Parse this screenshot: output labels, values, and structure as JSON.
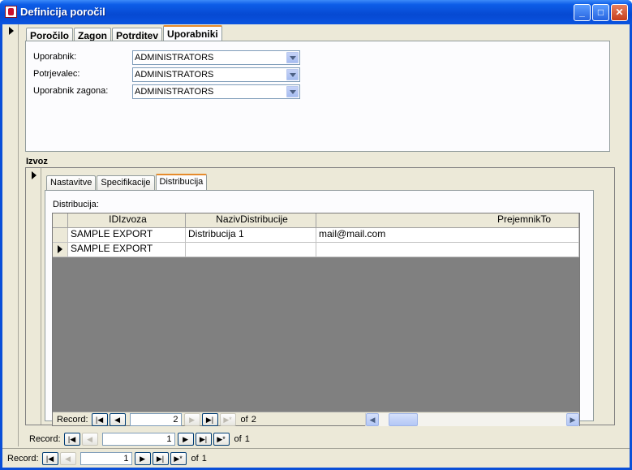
{
  "window": {
    "title": "Definicija poročil",
    "minimize_glyph": "_",
    "maximize_glyph": "□",
    "close_glyph": "✕"
  },
  "main_tabs": [
    "Poročilo",
    "Zagon",
    "Potrditev",
    "Uporabniki"
  ],
  "uporabniki": {
    "fields": [
      {
        "label": "Uporabnik:",
        "value": "ADMINISTRATORS"
      },
      {
        "label": "Potrjevalec:",
        "value": "ADMINISTRATORS"
      },
      {
        "label": "Uporabnik zagona:",
        "value": "ADMINISTRATORS"
      }
    ]
  },
  "izvoz": {
    "label": "Izvoz",
    "tabs": [
      "Nastavitve",
      "Specifikacije",
      "Distribucija"
    ],
    "distribucija": {
      "label": "Distribucija:",
      "columns": [
        "IDIzvoza",
        "NazivDistribucije",
        "PrejemnikTo"
      ],
      "rows": [
        [
          "SAMPLE EXPORT",
          "Distribucija 1",
          "mail@mail.com"
        ],
        [
          "SAMPLE EXPORT",
          "",
          ""
        ]
      ]
    }
  },
  "nav_inner": {
    "label": "Record:",
    "current": "2",
    "of_label": "of",
    "total": "2"
  },
  "nav_middle": {
    "label": "Record:",
    "current": "1",
    "of_label": "of",
    "total": "1"
  },
  "nav_outer": {
    "label": "Record:",
    "current": "1",
    "of_label": "of",
    "total": "1"
  }
}
